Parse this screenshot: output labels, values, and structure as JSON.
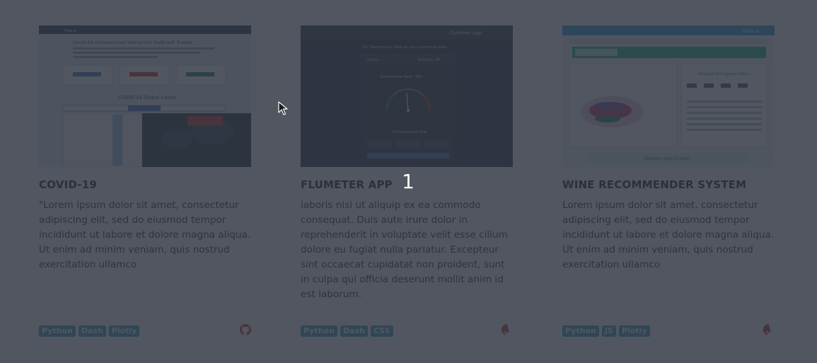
{
  "projects": [
    {
      "title": "COVID-19",
      "description": "\"Lorem ipsum dolor sit amet, consectetur adipiscing elit, sed do eiusmod tempor incididunt ut labore et dolore magna aliqua. Ut enim ad minim veniam, quis nostrud exercitation ullamco",
      "tags": [
        "Python",
        "Dash",
        "Plotly"
      ],
      "thumbnail": {
        "nav_brand": "Hola.ai",
        "heading": "Covid-19 (Coronavirus) Interactive Outbreak Tracker",
        "section_title": "COVID-19 Global Cases"
      }
    },
    {
      "title": "FLUMETER APP",
      "description": "laboris nisi ut aliquip ex ea commodo consequat. Duis aute irure dolor in reprehenderit in voluptate velit esse cillum dolore eu fugiat nulla pariatur. Excepteur sint occaecat cupidatat non proident, sunt in culpa qui officia deserunt mollit anim id est laborum.",
      "tags": [
        "Python",
        "Dash",
        "CSS"
      ],
      "thumbnail": {
        "app_title": "FluMeter App",
        "subtitle": "Flu Transmission Rate at your current location",
        "region_label": "Region",
        "region_value": "Brooklyn, NY",
        "gauge_title": "Transmission Rate - NYC",
        "rate_label": "Contamination Risk"
      }
    },
    {
      "title": "WINE RECOMMENDER SYSTEM",
      "description": "Lorem ipsum dolor sit amet, consectetur adipiscing elit, sed do eiusmod tempor incididunt ut labore et dolore magna aliqua. Ut enim ad minim veniam, quis nostrud exercitation ullamco",
      "tags": [
        "Python",
        "JS",
        "Plotly"
      ],
      "thumbnail": {
        "brand": "Hola.ai",
        "panel_title": "Portugal Portuguese Wine",
        "footer_label": "Reviews Specification"
      }
    }
  ],
  "slide_number": "1",
  "icons": {
    "repo": "github-icon",
    "pointer": "cursor-icon"
  },
  "colors": {
    "tag_bg": "#3da0bd",
    "overlay": "rgba(46,52,64,0.83)",
    "github": "#c0392b"
  }
}
